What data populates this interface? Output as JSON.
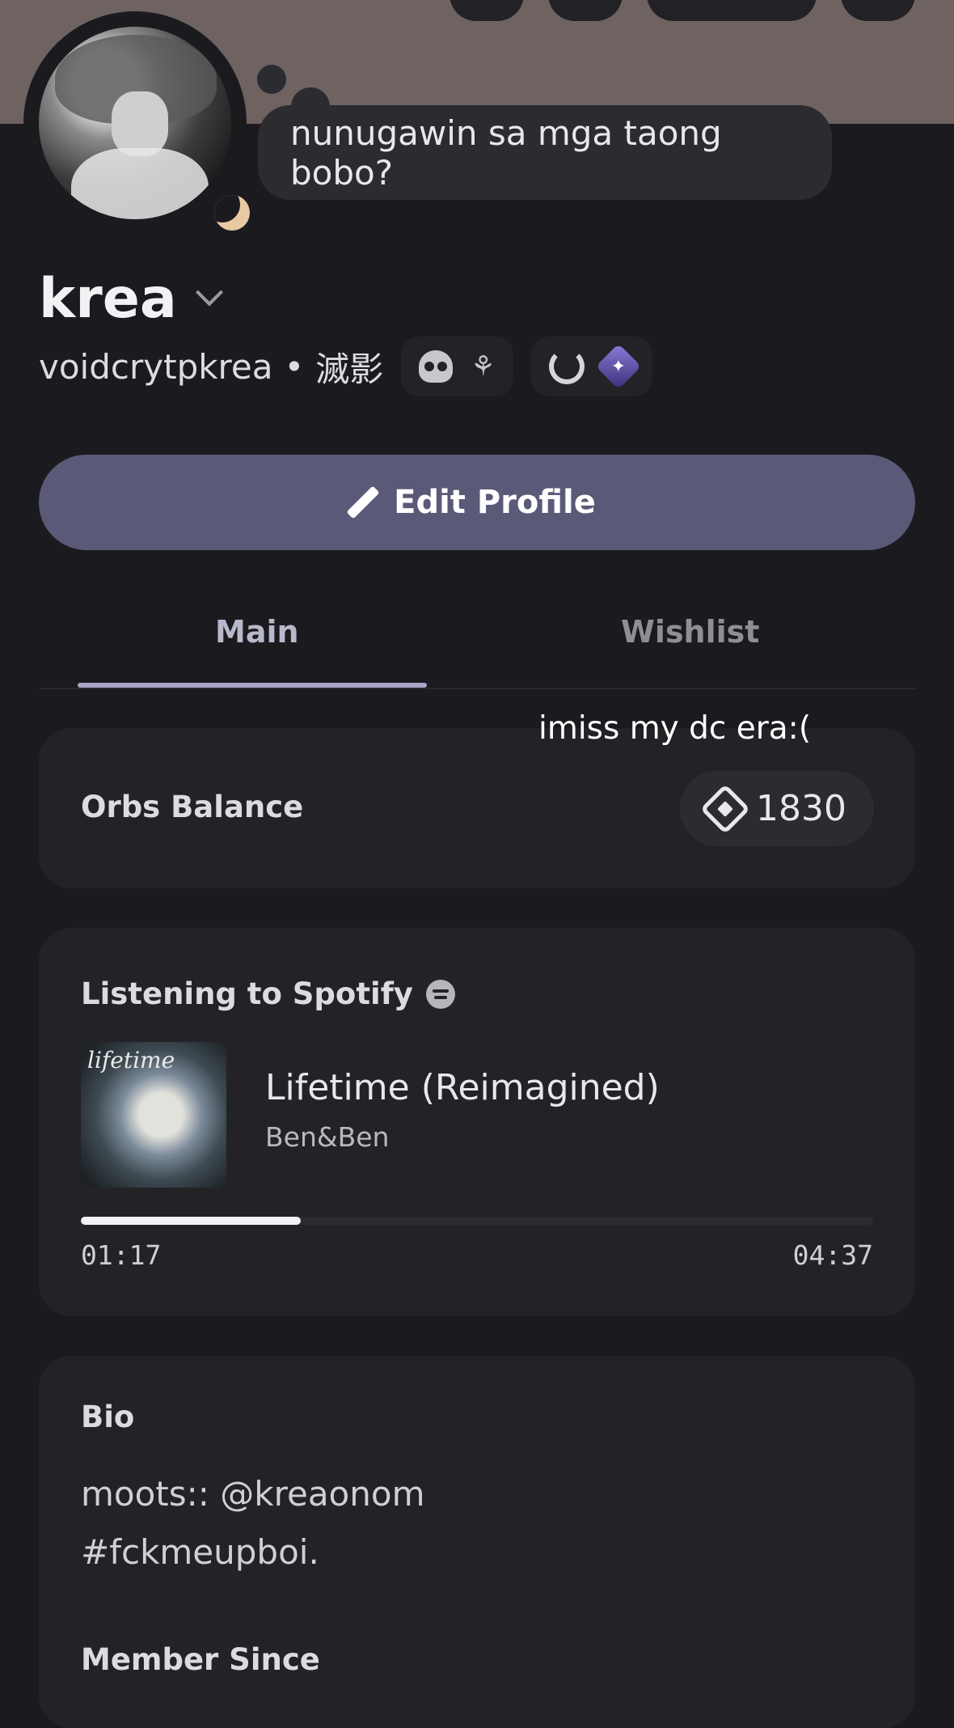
{
  "status_bubble": {
    "text": "nunugawin sa mga taong bobo?"
  },
  "profile": {
    "display_name": "krea",
    "username": "voidcrytpkrea",
    "separator": "•",
    "pronouns": "滅影",
    "status_icon": "moon-icon",
    "badges_group_1": [
      "skull-icon",
      "tree-icon"
    ],
    "badges_group_2": [
      "laurel-icon",
      "nitro-gem-icon"
    ]
  },
  "actions": {
    "edit_profile_label": "Edit Profile"
  },
  "tabs": [
    {
      "label": "Main",
      "active": true
    },
    {
      "label": "Wishlist",
      "active": false
    }
  ],
  "overlay_note": "imiss my dc era:(",
  "orbs": {
    "label": "Orbs Balance",
    "value": "1830"
  },
  "spotify": {
    "header": "Listening to Spotify",
    "album_text": "lifetime",
    "track": "Lifetime (Reimagined)",
    "artist": "Ben&Ben",
    "elapsed": "01:17",
    "total": "04:37",
    "progress": 0.278
  },
  "bio": {
    "header": "Bio",
    "lines": [
      "moots:: @kreaonom",
      "#fckmeupboi."
    ]
  },
  "member_since": {
    "header": "Member Since"
  },
  "colors": {
    "background": "#1b1b1f",
    "card": "#232327",
    "accent": "#5a5a78",
    "banner": "#6e6361"
  }
}
